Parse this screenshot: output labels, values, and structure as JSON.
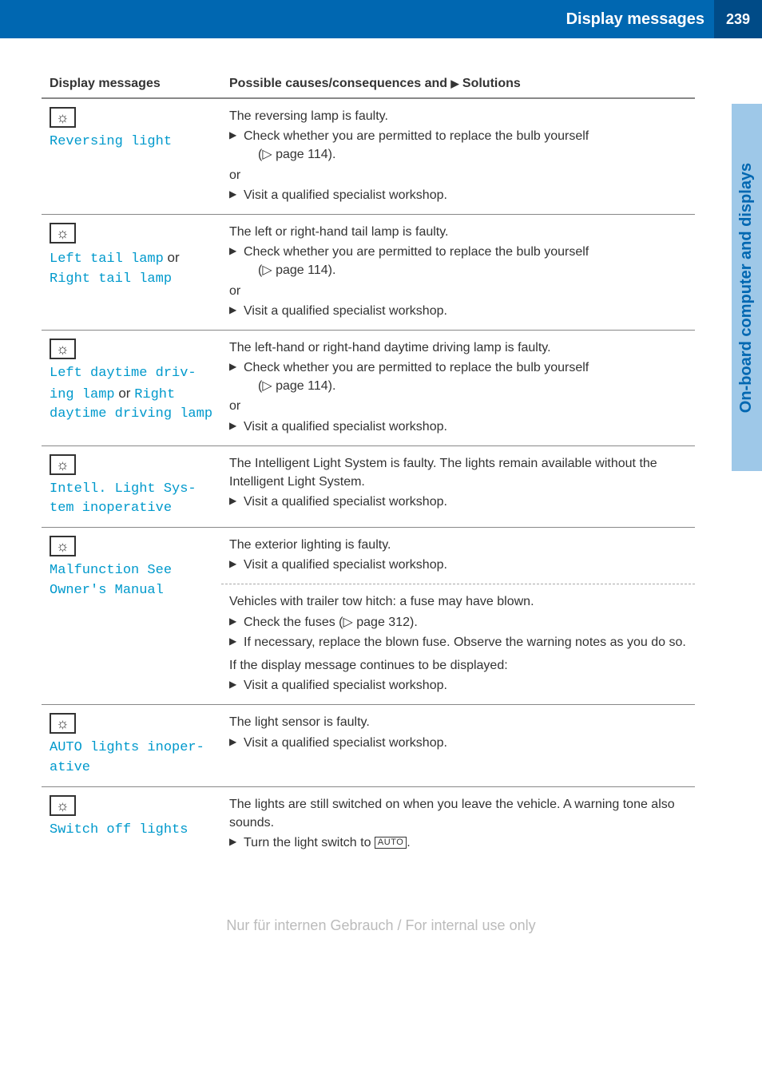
{
  "header": {
    "title": "Display messages",
    "page_number": "239"
  },
  "side_tab": "On-board computer and displays",
  "table": {
    "col1": "Display messages",
    "col2_a": "Possible causes/consequences and ",
    "col2_b": " Solutions"
  },
  "rows": {
    "r1": {
      "label": "Reversing light",
      "cause": "The reversing lamp is faulty.",
      "s1": "Check whether you are permitted to replace the bulb yourself",
      "s1b": "(▷ page 114).",
      "or": "or",
      "s2": "Visit a qualified specialist workshop."
    },
    "r2": {
      "label_a": "Left tail lamp",
      "label_or": " or ",
      "label_b": "Right tail lamp",
      "cause": "The left or right-hand tail lamp is faulty.",
      "s1": "Check whether you are permitted to replace the bulb yourself",
      "s1b": "(▷ page 114).",
      "or": "or",
      "s2": "Visit a qualified specialist workshop."
    },
    "r3": {
      "label_a": "Left daytime driv‐ ing lamp",
      "label_or": " or ",
      "label_b": "Right daytime driving lamp",
      "cause": "The left-hand or right-hand daytime driving lamp is faulty.",
      "s1": "Check whether you are permitted to replace the bulb yourself",
      "s1b": "(▷ page 114).",
      "or": "or",
      "s2": "Visit a qualified specialist workshop."
    },
    "r4": {
      "label": "Intell. Light Sys‐ tem inoperative",
      "cause": "The Intelligent Light System is faulty. The lights remain available without the Intelligent Light System.",
      "s1": "Visit a qualified specialist workshop."
    },
    "r5a": {
      "label": "Malfunction See Owner's Manual",
      "cause": "The exterior lighting is faulty.",
      "s1": "Visit a qualified specialist workshop."
    },
    "r5b": {
      "cause": "Vehicles with trailer tow hitch: a fuse may have blown.",
      "s1": "Check the fuses (▷ page 312).",
      "s2": "If necessary, replace the blown fuse. Observe the warning notes as you do so.",
      "cont": "If the display message continues to be displayed:",
      "s3": "Visit a qualified specialist workshop."
    },
    "r6": {
      "label": "AUTO lights inoper‐ ative",
      "cause": "The light sensor is faulty.",
      "s1": "Visit a qualified specialist workshop."
    },
    "r7": {
      "label": "Switch off lights",
      "cause": "The lights are still switched on when you leave the vehicle. A warning tone also sounds.",
      "s1a": "Turn the light switch to ",
      "auto": "AUTO",
      "s1b": "."
    }
  },
  "footer": "Nur für internen Gebrauch / For internal use only"
}
